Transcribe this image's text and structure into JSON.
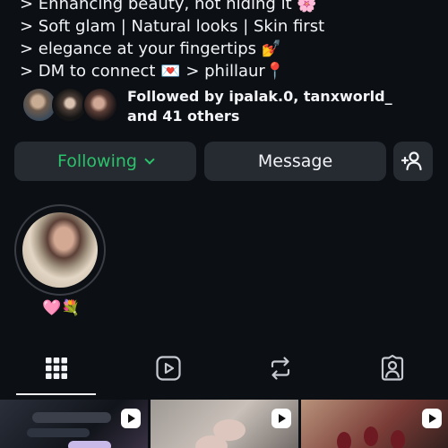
{
  "bio": {
    "lines": [
      "> Enhancing beauty, not hiding it 🌸",
      "> Soft glam | Natural looks | Skin first",
      "> elegance at your fingertips 💅",
      "> DM to connect 💌 > phillaur📍"
    ]
  },
  "followed_by": {
    "line1": "Followed by ipalak.0, tanxworld_",
    "line2": "and 41 others"
  },
  "actions": {
    "following_label": "Following",
    "message_label": "Message",
    "add_user_icon": "person-plus-icon"
  },
  "highlight": {
    "label": "🩷💐"
  },
  "tabs": [
    {
      "icon": "grid-icon",
      "active": true
    },
    {
      "icon": "reels-icon",
      "active": false
    },
    {
      "icon": "reposts-icon",
      "active": false
    },
    {
      "icon": "tagged-icon",
      "active": false
    }
  ],
  "colors": {
    "background": "#0c0f14",
    "button": "#262a31",
    "following_green": "#2bc26b",
    "text": "#f2f4f7"
  }
}
